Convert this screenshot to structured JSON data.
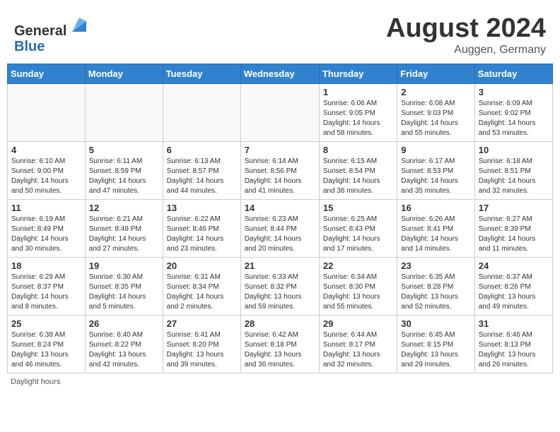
{
  "header": {
    "logo_line1": "General",
    "logo_line2": "Blue",
    "month": "August 2024",
    "location": "Auggen, Germany"
  },
  "weekdays": [
    "Sunday",
    "Monday",
    "Tuesday",
    "Wednesday",
    "Thursday",
    "Friday",
    "Saturday"
  ],
  "weeks": [
    [
      {
        "day": "",
        "info": ""
      },
      {
        "day": "",
        "info": ""
      },
      {
        "day": "",
        "info": ""
      },
      {
        "day": "",
        "info": ""
      },
      {
        "day": "1",
        "info": "Sunrise: 6:06 AM\nSunset: 9:05 PM\nDaylight: 14 hours\nand 58 minutes."
      },
      {
        "day": "2",
        "info": "Sunrise: 6:08 AM\nSunset: 9:03 PM\nDaylight: 14 hours\nand 55 minutes."
      },
      {
        "day": "3",
        "info": "Sunrise: 6:09 AM\nSunset: 9:02 PM\nDaylight: 14 hours\nand 53 minutes."
      }
    ],
    [
      {
        "day": "4",
        "info": "Sunrise: 6:10 AM\nSunset: 9:00 PM\nDaylight: 14 hours\nand 50 minutes."
      },
      {
        "day": "5",
        "info": "Sunrise: 6:11 AM\nSunset: 8:59 PM\nDaylight: 14 hours\nand 47 minutes."
      },
      {
        "day": "6",
        "info": "Sunrise: 6:13 AM\nSunset: 8:57 PM\nDaylight: 14 hours\nand 44 minutes."
      },
      {
        "day": "7",
        "info": "Sunrise: 6:14 AM\nSunset: 8:56 PM\nDaylight: 14 hours\nand 41 minutes."
      },
      {
        "day": "8",
        "info": "Sunrise: 6:15 AM\nSunset: 8:54 PM\nDaylight: 14 hours\nand 38 minutes."
      },
      {
        "day": "9",
        "info": "Sunrise: 6:17 AM\nSunset: 8:53 PM\nDaylight: 14 hours\nand 35 minutes."
      },
      {
        "day": "10",
        "info": "Sunrise: 6:18 AM\nSunset: 8:51 PM\nDaylight: 14 hours\nand 32 minutes."
      }
    ],
    [
      {
        "day": "11",
        "info": "Sunrise: 6:19 AM\nSunset: 8:49 PM\nDaylight: 14 hours\nand 30 minutes."
      },
      {
        "day": "12",
        "info": "Sunrise: 6:21 AM\nSunset: 8:48 PM\nDaylight: 14 hours\nand 27 minutes."
      },
      {
        "day": "13",
        "info": "Sunrise: 6:22 AM\nSunset: 8:46 PM\nDaylight: 14 hours\nand 23 minutes."
      },
      {
        "day": "14",
        "info": "Sunrise: 6:23 AM\nSunset: 8:44 PM\nDaylight: 14 hours\nand 20 minutes."
      },
      {
        "day": "15",
        "info": "Sunrise: 6:25 AM\nSunset: 8:43 PM\nDaylight: 14 hours\nand 17 minutes."
      },
      {
        "day": "16",
        "info": "Sunrise: 6:26 AM\nSunset: 8:41 PM\nDaylight: 14 hours\nand 14 minutes."
      },
      {
        "day": "17",
        "info": "Sunrise: 6:27 AM\nSunset: 8:39 PM\nDaylight: 14 hours\nand 11 minutes."
      }
    ],
    [
      {
        "day": "18",
        "info": "Sunrise: 6:29 AM\nSunset: 8:37 PM\nDaylight: 14 hours\nand 8 minutes."
      },
      {
        "day": "19",
        "info": "Sunrise: 6:30 AM\nSunset: 8:35 PM\nDaylight: 14 hours\nand 5 minutes."
      },
      {
        "day": "20",
        "info": "Sunrise: 6:31 AM\nSunset: 8:34 PM\nDaylight: 14 hours\nand 2 minutes."
      },
      {
        "day": "21",
        "info": "Sunrise: 6:33 AM\nSunset: 8:32 PM\nDaylight: 13 hours\nand 59 minutes."
      },
      {
        "day": "22",
        "info": "Sunrise: 6:34 AM\nSunset: 8:30 PM\nDaylight: 13 hours\nand 55 minutes."
      },
      {
        "day": "23",
        "info": "Sunrise: 6:35 AM\nSunset: 8:28 PM\nDaylight: 13 hours\nand 52 minutes."
      },
      {
        "day": "24",
        "info": "Sunrise: 6:37 AM\nSunset: 8:26 PM\nDaylight: 13 hours\nand 49 minutes."
      }
    ],
    [
      {
        "day": "25",
        "info": "Sunrise: 6:38 AM\nSunset: 8:24 PM\nDaylight: 13 hours\nand 46 minutes."
      },
      {
        "day": "26",
        "info": "Sunrise: 6:40 AM\nSunset: 8:22 PM\nDaylight: 13 hours\nand 42 minutes."
      },
      {
        "day": "27",
        "info": "Sunrise: 6:41 AM\nSunset: 8:20 PM\nDaylight: 13 hours\nand 39 minutes."
      },
      {
        "day": "28",
        "info": "Sunrise: 6:42 AM\nSunset: 8:18 PM\nDaylight: 13 hours\nand 36 minutes."
      },
      {
        "day": "29",
        "info": "Sunrise: 6:44 AM\nSunset: 8:17 PM\nDaylight: 13 hours\nand 32 minutes."
      },
      {
        "day": "30",
        "info": "Sunrise: 6:45 AM\nSunset: 8:15 PM\nDaylight: 13 hours\nand 29 minutes."
      },
      {
        "day": "31",
        "info": "Sunrise: 6:46 AM\nSunset: 8:13 PM\nDaylight: 13 hours\nand 26 minutes."
      }
    ]
  ],
  "footer": "Daylight hours"
}
